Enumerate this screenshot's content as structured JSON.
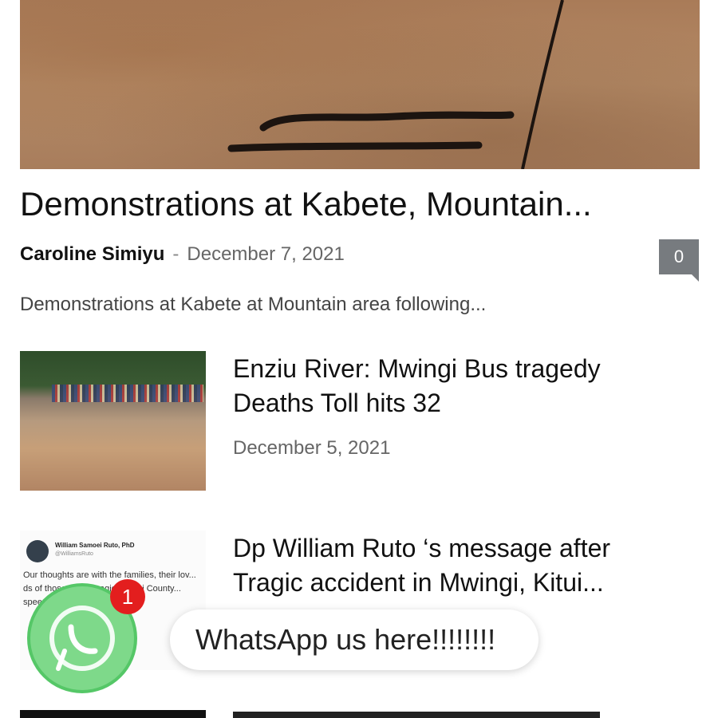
{
  "featured": {
    "title": "Demonstrations at Kabete, Mountain...",
    "author": "Caroline Simiyu",
    "separator": "-",
    "date": "December 7, 2021",
    "comments": "0",
    "excerpt": "Demonstrations at Kabete at Mountain area following..."
  },
  "articles": [
    {
      "title": "Enziu River: Mwingi Bus tragedy Deaths Toll hits 32",
      "date": "December 5, 2021"
    },
    {
      "title": "Dp William Ruto ‘s message after Tragic accident in Mwingi, Kitui...",
      "tweet": {
        "name": "William Samoei Ruto, PhD",
        "handle": "@WilliamsRuto",
        "text": "Our thoughts are with the families, their lov... ds of those who... tragic ac... ui County... speed..."
      }
    }
  ],
  "whatsapp": {
    "badge_count": "1",
    "tooltip": "WhatsApp us here!!!!!!!!"
  },
  "colors": {
    "whatsapp_green": "#55c767",
    "badge_red": "#e31e1e",
    "comment_gray": "#777b7f"
  }
}
